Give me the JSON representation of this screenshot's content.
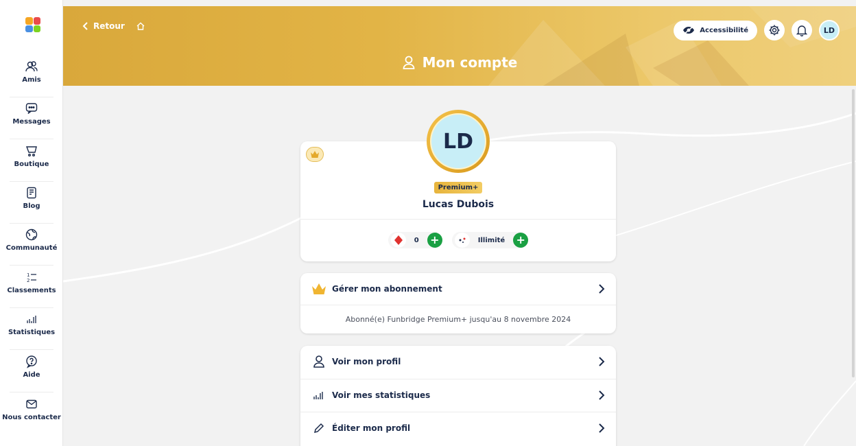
{
  "sidebar": {
    "items": [
      {
        "label": "Amis",
        "icon": "friends-icon"
      },
      {
        "label": "Messages",
        "icon": "message-icon"
      },
      {
        "label": "Boutique",
        "icon": "cart-icon"
      },
      {
        "label": "Blog",
        "icon": "blog-icon"
      },
      {
        "label": "Communauté",
        "icon": "globe-icon"
      },
      {
        "label": "Classements",
        "icon": "ranking-icon"
      },
      {
        "label": "Statistiques",
        "icon": "stats-icon"
      },
      {
        "label": "Aide",
        "icon": "help-icon"
      },
      {
        "label": "Nous contacter",
        "icon": "mail-icon"
      }
    ]
  },
  "header": {
    "back_label": "Retour",
    "title": "Mon compte",
    "accessibility_label": "Accessibilité",
    "user_initials": "LD"
  },
  "profile": {
    "initials": "LD",
    "badge": "Premium+",
    "name": "Lucas Dubois",
    "diamonds": "0",
    "deals": "Illimité"
  },
  "subscription": {
    "label": "Gérer mon abonnement",
    "info": "Abonné(e) Funbridge Premium+ jusqu'au 8 novembre 2024"
  },
  "menu": {
    "items": [
      {
        "label": "Voir mon profil",
        "icon": "user-icon"
      },
      {
        "label": "Voir mes statistiques",
        "icon": "stats-icon"
      },
      {
        "label": "Éditer mon profil",
        "icon": "pencil-icon"
      }
    ]
  },
  "colors": {
    "banner": "#e2b446",
    "accent_green": "#1aa043",
    "navy": "#1b2a4a",
    "avatar_bg": "#c8eef7"
  }
}
